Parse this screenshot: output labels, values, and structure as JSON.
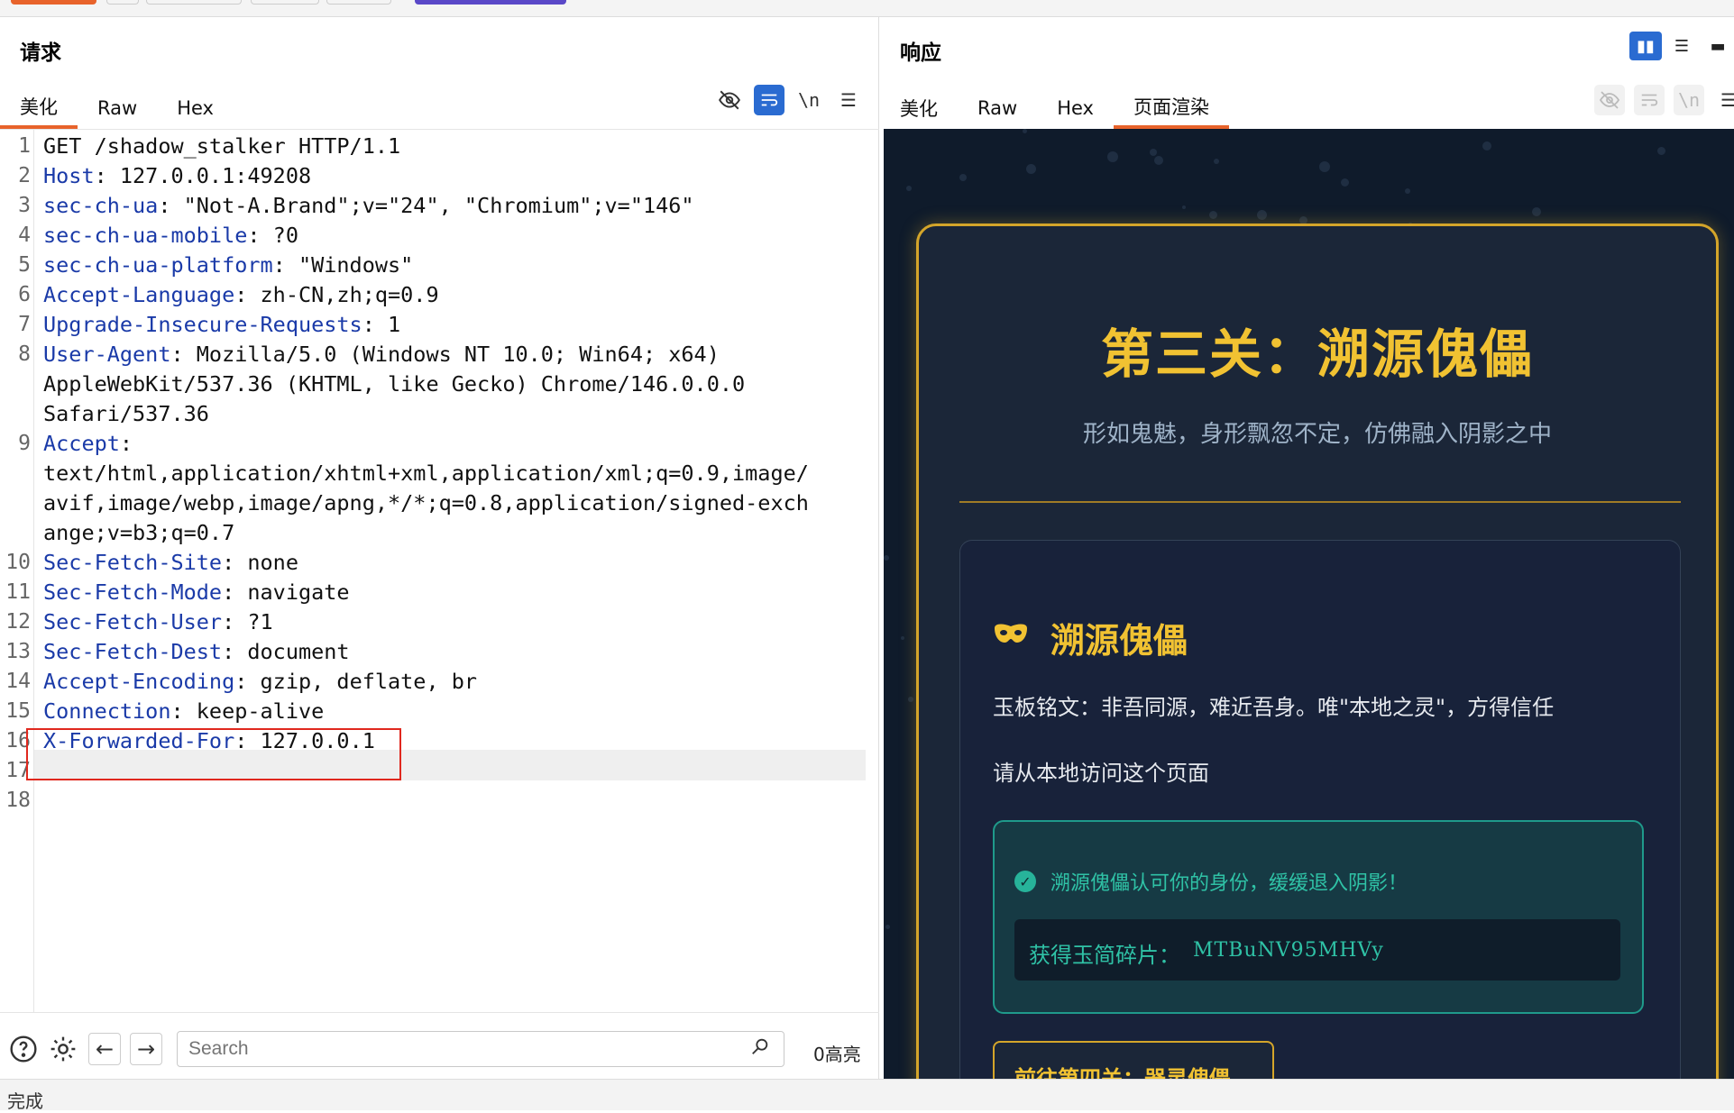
{
  "request": {
    "title": "请求",
    "tabs": [
      "美化",
      "Raw",
      "Hex"
    ],
    "lines": [
      {
        "n": "1",
        "key": "",
        "val": "GET /shadow_stalker HTTP/1.1"
      },
      {
        "n": "2",
        "key": "Host",
        "val": ": 127.0.0.1:49208"
      },
      {
        "n": "3",
        "key": "sec-ch-ua",
        "val": ": \"Not-A.Brand\";v=\"24\", \"Chromium\";v=\"146\""
      },
      {
        "n": "4",
        "key": "sec-ch-ua-mobile",
        "val": ": ?0"
      },
      {
        "n": "5",
        "key": "sec-ch-ua-platform",
        "val": ": \"Windows\""
      },
      {
        "n": "6",
        "key": "Accept-Language",
        "val": ": zh-CN,zh;q=0.9"
      },
      {
        "n": "7",
        "key": "Upgrade-Insecure-Requests",
        "val": ": 1"
      },
      {
        "n": "8",
        "key": "User-Agent",
        "val": ": Mozilla/5.0 (Windows NT 10.0; Win64; x64)"
      },
      {
        "n": "",
        "key": "",
        "val": "AppleWebKit/537.36 (KHTML, like Gecko) Chrome/146.0.0.0"
      },
      {
        "n": "",
        "key": "",
        "val": "Safari/537.36"
      },
      {
        "n": "9",
        "key": "Accept",
        "val": ":"
      },
      {
        "n": "",
        "key": "",
        "val": "text/html,application/xhtml+xml,application/xml;q=0.9,image/"
      },
      {
        "n": "",
        "key": "",
        "val": "avif,image/webp,image/apng,*/*;q=0.8,application/signed-exch"
      },
      {
        "n": "",
        "key": "",
        "val": "ange;v=b3;q=0.7"
      },
      {
        "n": "10",
        "key": "Sec-Fetch-Site",
        "val": ": none"
      },
      {
        "n": "11",
        "key": "Sec-Fetch-Mode",
        "val": ": navigate"
      },
      {
        "n": "12",
        "key": "Sec-Fetch-User",
        "val": ": ?1"
      },
      {
        "n": "13",
        "key": "Sec-Fetch-Dest",
        "val": ": document"
      },
      {
        "n": "14",
        "key": "Accept-Encoding",
        "val": ": gzip, deflate, br"
      },
      {
        "n": "15",
        "key": "Connection",
        "val": ": keep-alive"
      },
      {
        "n": "16",
        "key": "X-Forwarded-For",
        "val": ": 127.0.0.1"
      },
      {
        "n": "17",
        "key": "",
        "val": ""
      },
      {
        "n": "18",
        "key": "",
        "val": ""
      }
    ],
    "search_placeholder": "Search",
    "highlight_count": "0高亮"
  },
  "response": {
    "title": "响应",
    "tabs": [
      "美化",
      "Raw",
      "Hex",
      "页面渲染"
    ],
    "page": {
      "h1": "第三关：溯源傀儡",
      "subtitle": "形如鬼魅，身形飘忽不定，仿佛融入阴影之中",
      "h2": "溯源傀儡",
      "jade_text": "玉板铭文：非吾同源，难近吾身。唯\"本地之灵\"，方得信任",
      "local_text": "请从本地访问这个页面",
      "success_msg": "溯源傀儡认可你的身份，缓缓退入阴影！",
      "flag_label": "获得玉简碎片：",
      "flag_value": "MTBuNV95MHVy",
      "next_button": "前往第四关：器灵傀儡"
    }
  },
  "status_text": "完成"
}
